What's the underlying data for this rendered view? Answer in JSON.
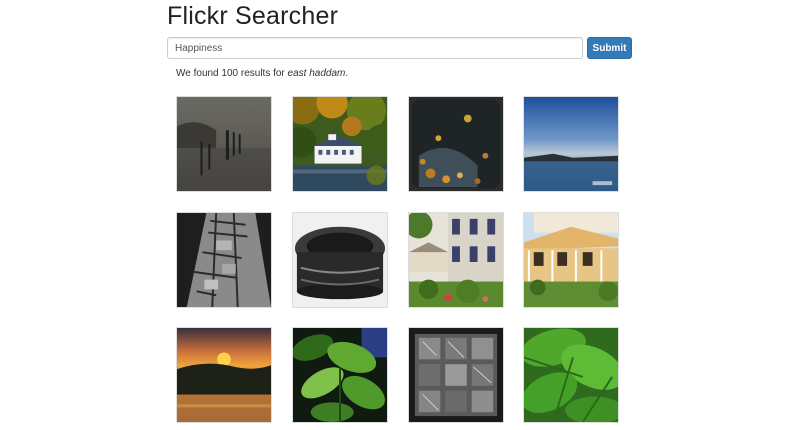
{
  "header": {
    "title": "Flickr Searcher"
  },
  "search": {
    "value": "Happiness",
    "submit_label": "Submit"
  },
  "results": {
    "prefix": "We found 100 results for ",
    "query": "east haddam",
    "suffix": "."
  },
  "photos": [
    {
      "name": "photo-misty-river-pilings"
    },
    {
      "name": "photo-white-mansion-autumn"
    },
    {
      "name": "photo-autumn-leaves-puddle"
    },
    {
      "name": "photo-blue-fog-lake"
    },
    {
      "name": "photo-cobblestone-path"
    },
    {
      "name": "photo-ornate-bowl-rim"
    },
    {
      "name": "photo-house-porch-garden"
    },
    {
      "name": "photo-yellow-house-porch"
    },
    {
      "name": "photo-sunset-over-hills"
    },
    {
      "name": "photo-green-leaves-plant"
    },
    {
      "name": "photo-window-panes-bw"
    },
    {
      "name": "photo-green-leaf-closeup"
    }
  ]
}
